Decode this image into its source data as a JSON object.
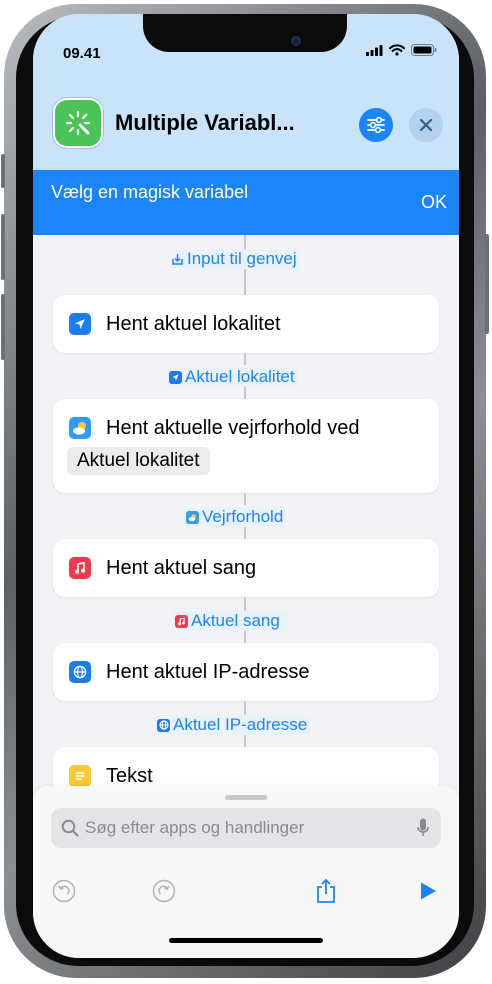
{
  "status_bar": {
    "time": "09.41"
  },
  "header": {
    "title": "Multiple Variabl..."
  },
  "banner": {
    "text": "Vælg en magisk variabel",
    "ok_label": "OK"
  },
  "workflow": {
    "input_token": "Input til genvej",
    "actions": [
      {
        "label": "Hent aktuel lokalitet",
        "icon": "location-arrow-icon",
        "color": "#1b7cf4",
        "output": "Aktuel lokalitet"
      },
      {
        "label": "Hent aktuelle vejrforhold ved",
        "param": "Aktuel lokalitet",
        "icon": "weather-icon",
        "color": "#2f9cf5",
        "output": "Vejrforhold"
      },
      {
        "label": "Hent aktuel sang",
        "icon": "music-note-icon",
        "color": "#f0384f",
        "output": "Aktuel sang"
      },
      {
        "label": "Hent aktuel IP-adresse",
        "icon": "globe-icon",
        "color": "#1b7cf4",
        "output": "Aktuel IP-adresse"
      },
      {
        "label": "Tekst",
        "icon": "text-icon",
        "color": "#f8c934"
      }
    ]
  },
  "search": {
    "placeholder": "Søg efter apps og handlinger"
  },
  "colors": {
    "accent": "#1b84f7",
    "header_bg": "#c8e3fa",
    "app_icon": "#4bc358"
  }
}
